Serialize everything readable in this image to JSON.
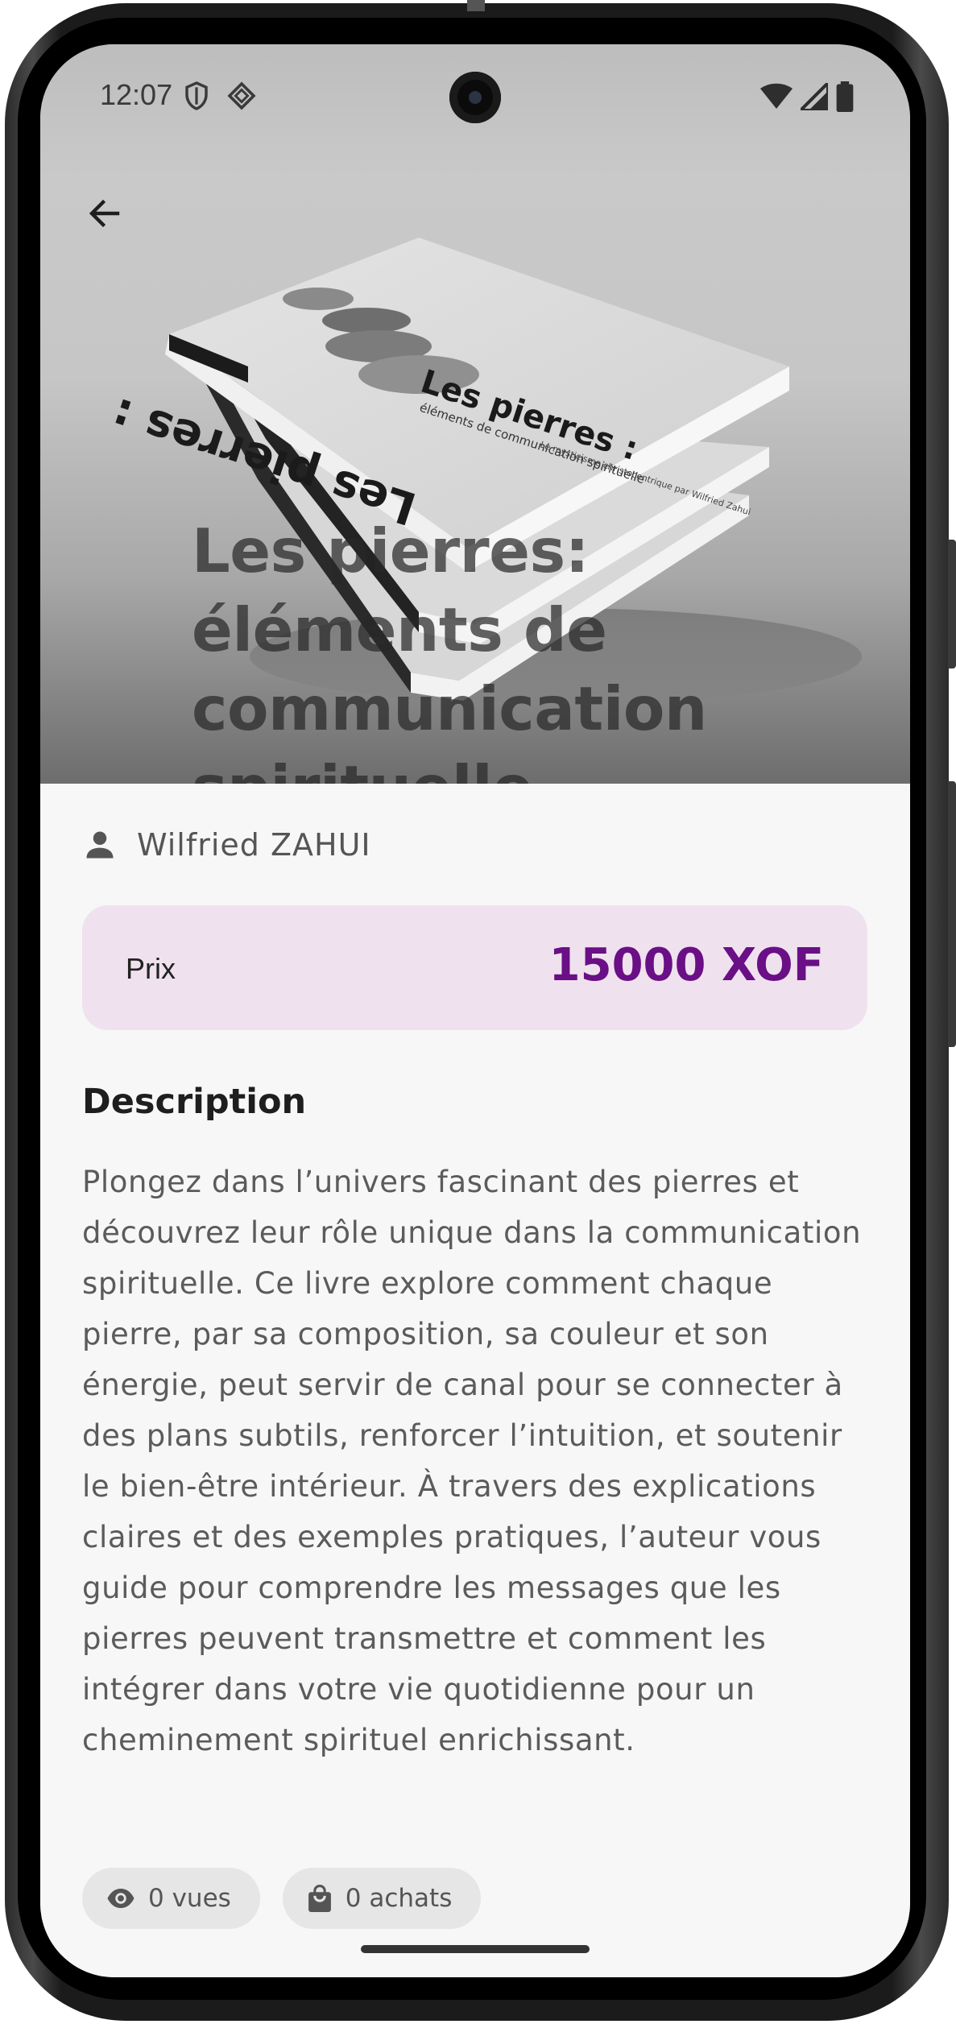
{
  "status_bar": {
    "time": "12:07",
    "icons": [
      "shield-icon",
      "diamond-icon",
      "wifi-icon",
      "signal-icon",
      "battery-icon"
    ]
  },
  "header": {
    "back_icon": "arrow-left-icon"
  },
  "book": {
    "title": "Les pierres: éléments de communication spirituelle",
    "cover_title": "Les pierres :",
    "cover_subtitle": "éléments de communication spirituelle",
    "cover_author_line": "Le mysticisme christocentrique par Wilfried Zahui"
  },
  "author": {
    "icon": "person-icon",
    "name": "Wilfried ZAHUI"
  },
  "price": {
    "label": "Prix",
    "value": "15000 XOF",
    "accent_color": "#6a0f86",
    "card_color": "#efe2ee"
  },
  "description": {
    "title": "Description",
    "text": "Plongez dans l’univers fascinant des pierres et découvrez leur rôle unique dans la communication spirituelle. Ce livre explore comment chaque pierre, par sa composition, sa couleur et son énergie, peut servir de canal pour se connecter à des plans subtils, renforcer l’intuition, et soutenir le bien-être intérieur. À travers des explications claires et des exemples pratiques, l’auteur vous guide pour comprendre les messages que les pierres peuvent transmettre et comment les intégrer dans votre vie quotidienne pour un cheminement spirituel enrichissant."
  },
  "stats": {
    "views_label": "0 vues",
    "views_icon": "eye-icon",
    "purchases_label": "0 achats",
    "purchases_icon": "shopping-bag-icon"
  }
}
